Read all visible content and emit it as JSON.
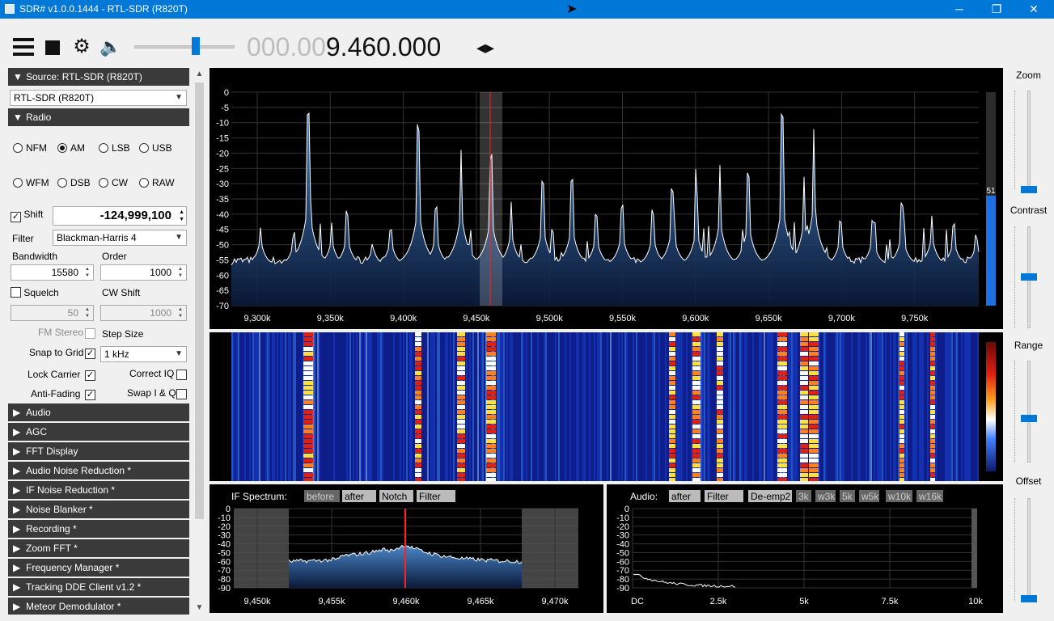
{
  "window": {
    "title": "SDR# v1.0.0.1444 - RTL-SDR (R820T)",
    "minimize": "─",
    "maximize": "❐",
    "close": "✕"
  },
  "toolbar": {
    "frequency_dim": "000.00",
    "frequency_bright": "9.460.000",
    "freq_arrows": "◂▸",
    "volume_level": 0.6
  },
  "left_panel": {
    "source_header": "Source: RTL-SDR (R820T)",
    "source_device": "RTL-SDR (R820T)",
    "radio_header": "Radio",
    "modes": [
      "NFM",
      "AM",
      "LSB",
      "USB",
      "WFM",
      "DSB",
      "CW",
      "RAW"
    ],
    "selected_mode": "AM",
    "shift_label": "Shift",
    "shift_value": "-124,999,100",
    "filter_label": "Filter",
    "filter_value": "Blackman-Harris 4",
    "bandwidth_label": "Bandwidth",
    "bandwidth_value": "15580",
    "order_label": "Order",
    "order_value": "1000",
    "squelch_label": "Squelch",
    "squelch_value": "50",
    "cw_shift_label": "CW Shift",
    "cw_shift_value": "1000",
    "fm_stereo_label": "FM Stereo",
    "step_size_label": "Step Size",
    "snap_label": "Snap to Grid",
    "step_value": "1 kHz",
    "lock_carrier_label": "Lock Carrier",
    "correct_iq_label": "Correct IQ",
    "anti_fading_label": "Anti-Fading",
    "swap_iq_label": "Swap I & Q",
    "collapsed_sections": [
      "Audio",
      "AGC",
      "FFT Display",
      "Audio Noise Reduction *",
      "IF Noise Reduction *",
      "Noise Blanker *",
      "Recording *",
      "Zoom FFT *",
      "Frequency Manager *",
      "Tracking DDE Client v1.2 *",
      "Meteor Demodulator *"
    ]
  },
  "spectrum": {
    "y_ticks": [
      "0",
      "-5",
      "-10",
      "-15",
      "-20",
      "-25",
      "-30",
      "-35",
      "-40",
      "-45",
      "-50",
      "-55",
      "-60",
      "-65",
      "-70"
    ],
    "x_ticks": [
      "9,300k",
      "9,350k",
      "9,400k",
      "9,450k",
      "9,500k",
      "9,550k",
      "9,600k",
      "9,650k",
      "9,700k",
      "9,750k"
    ],
    "snr_value": "51"
  },
  "if_spectrum": {
    "label": "IF Spectrum:",
    "buttons": [
      "before",
      "after",
      "Notch",
      "Filter"
    ],
    "y_ticks": [
      "0",
      "-10",
      "-20",
      "-30",
      "-40",
      "-50",
      "-60",
      "-70",
      "-80",
      "-90"
    ],
    "x_ticks": [
      "9,450k",
      "9,455k",
      "9,460k",
      "9,465k",
      "9,470k"
    ]
  },
  "audio_spectrum": {
    "label": "Audio:",
    "buttons": [
      "after",
      "Filter",
      "De-emp2",
      "3k",
      "w3k",
      "5k",
      "w5k",
      "w10k",
      "w16k"
    ],
    "y_ticks": [
      "0",
      "-10",
      "-20",
      "-30",
      "-40",
      "-50",
      "-60",
      "-70",
      "-80",
      "-90"
    ],
    "x_ticks": [
      "DC",
      "2.5k",
      "5k",
      "7.5k",
      "10k"
    ]
  },
  "right_panel": {
    "zoom_label": "Zoom",
    "contrast_label": "Contrast",
    "range_label": "Range",
    "offset_label": "Offset"
  },
  "colors": {
    "accent": "#0078d7",
    "section_header": "#3a3a3a",
    "spectrum_fill": "#1f4e8f",
    "marker": "#ff2020"
  }
}
